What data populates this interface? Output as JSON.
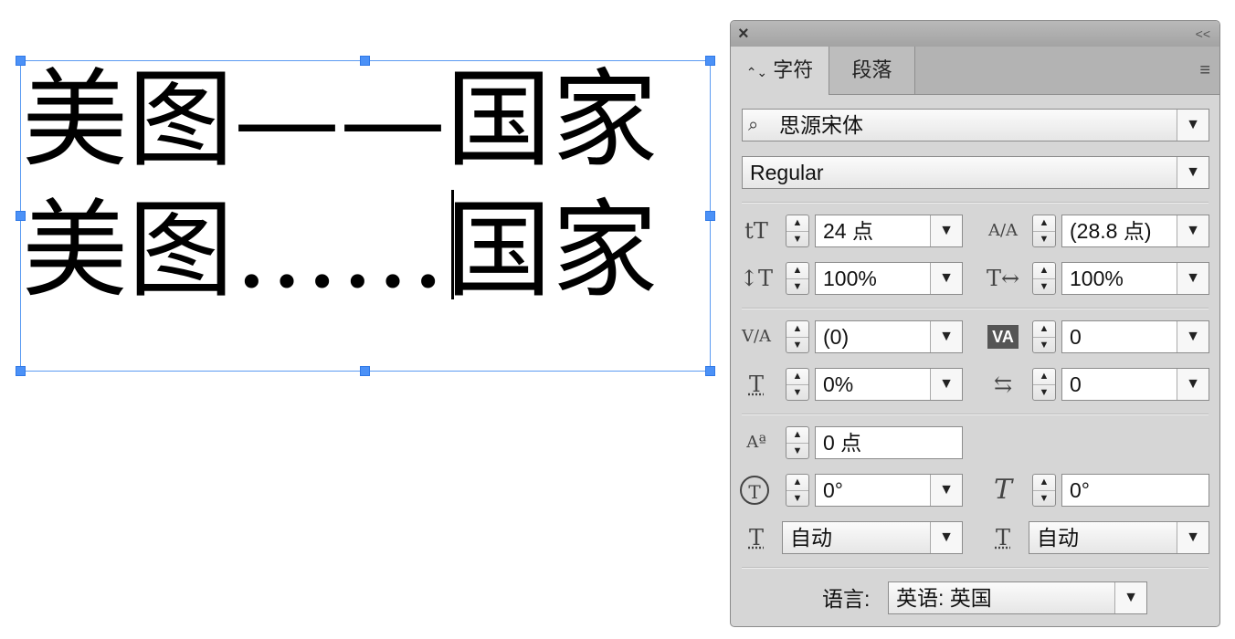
{
  "canvas": {
    "line1": "美图——国家",
    "line2": "美图……国家"
  },
  "panel": {
    "close_icon": "×",
    "collapse_icon": "<<",
    "tabs": {
      "character": "字符",
      "character_arrows": "⌃⌄",
      "paragraph": "段落"
    },
    "menu_icon": "≡",
    "font_family": "思源宋体",
    "font_search_icon": "⌕",
    "font_style": "Regular",
    "font_size": "24 点",
    "leading": "(28.8 点)",
    "vertical_scale": "100%",
    "horizontal_scale": "100%",
    "kerning": "(0)",
    "tracking": "0",
    "tsume": "0%",
    "aki": "0",
    "baseline_shift": "0 点",
    "rotation": "0°",
    "skew": "0°",
    "insert_space_before": "自动",
    "insert_space_after": "自动",
    "language_label": "语言:",
    "language": "英语: 英国",
    "dropdown_glyph": "▼",
    "step_up": "▲",
    "step_down": "▼"
  },
  "icons": {
    "font_size_icon": "tT",
    "leading_icon": "A/A",
    "vertical_scale_icon": "↕T",
    "horizontal_scale_icon": "T↔",
    "kerning_icon": "V/A",
    "tracking_icon": "VA",
    "tsume_icon": "T",
    "aki_icon": "⇆",
    "baseline_icon": "Aª",
    "rotation_icon": "T",
    "skew_icon": "T",
    "space_before_icon": "T",
    "space_after_icon": "T"
  },
  "colors": {
    "selection_blue": "#4b91f7",
    "panel_bg": "#d6d6d6"
  }
}
